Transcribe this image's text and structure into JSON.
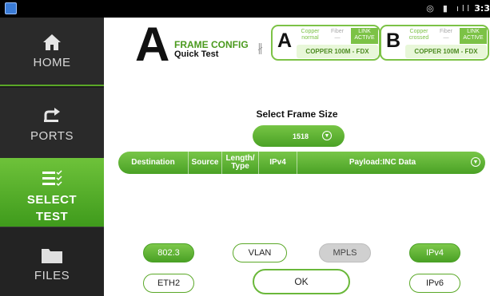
{
  "status_bar": {
    "clock": "3:3"
  },
  "nav": {
    "home": "HOME",
    "ports": "PORTS",
    "select_test_line1": "SELECT",
    "select_test_line2": "TEST",
    "files": "FILES"
  },
  "header": {
    "big_letter": "A",
    "title": "FRAME CONFIG",
    "subtitle": "Quick Test"
  },
  "port_a": {
    "letter": "A",
    "copper_line1": "Copper",
    "copper_line2": "normal",
    "fiber_line1": "Fiber",
    "fiber_line2": "—",
    "link_line1": "LINK",
    "link_line2": "ACTIVE",
    "status": "COPPER 100M  - FDX"
  },
  "port_b": {
    "letter": "B",
    "copper_line1": "Copper",
    "copper_line2": "crossed",
    "fiber_line1": "Fiber",
    "fiber_line2": "—",
    "link_line1": "LINK",
    "link_line2": "ACTIVE",
    "status": "COPPER 100M  - FDX"
  },
  "frame_size": {
    "label": "Select Frame Size",
    "value": "1518"
  },
  "frame_header": {
    "destination": "Destination",
    "source": "Source",
    "length_type_1": "Length/",
    "length_type_2": "Type",
    "ipv4": "IPv4",
    "payload": "Payload:INC Data"
  },
  "protocols": {
    "p8023": "802.3",
    "vlan": "VLAN",
    "mpls": "MPLS",
    "ipv4": "IPv4",
    "eth2": "ETH2",
    "ok": "OK",
    "ipv6": "IPv6"
  },
  "colors": {
    "accent_green": "#5aa827",
    "sidebar_bg": "#1d1d1d"
  }
}
